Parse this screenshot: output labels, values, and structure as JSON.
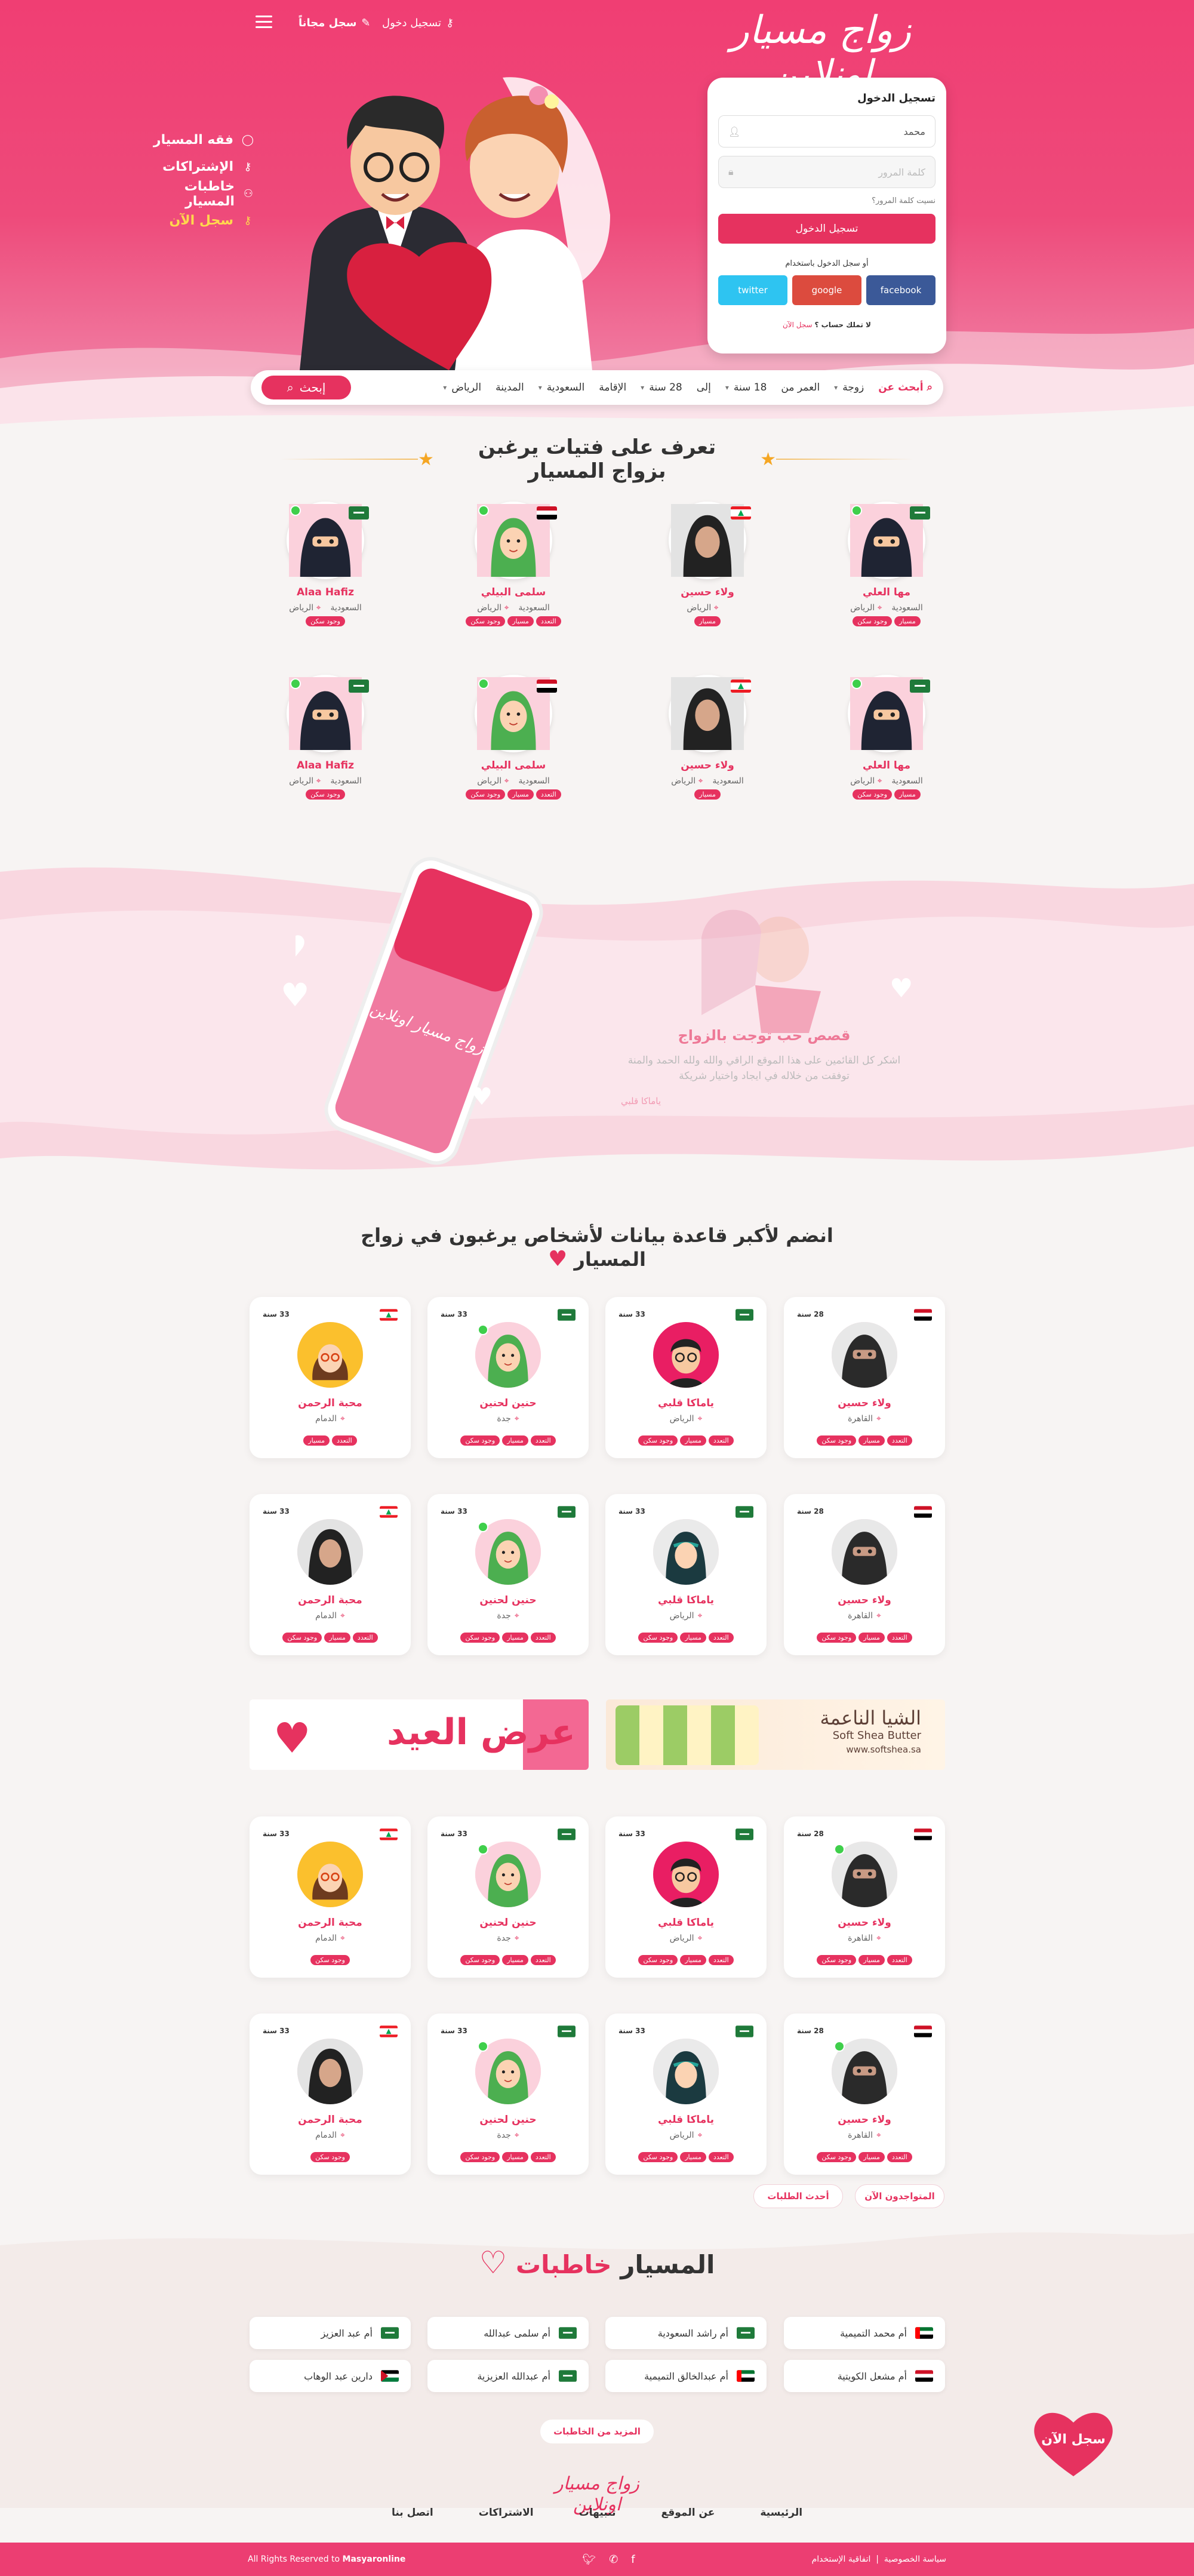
{
  "header": {
    "logo": "زواج مسيار اونلاين",
    "login_link": "تسجيل دخول",
    "register_link": "سجل مجاناً"
  },
  "side_nav": [
    {
      "label": "فقه المسيار",
      "icon": "circle-icon"
    },
    {
      "label": "الإشتراكات",
      "icon": "key-icon"
    },
    {
      "label": "خاطبات المسيار",
      "icon": "users-icon"
    },
    {
      "label": "سجل الآن",
      "icon": "key-icon"
    }
  ],
  "login": {
    "title": "تسجيل الدخول",
    "username_value": "محمد",
    "password_placeholder": "كلمة المرور",
    "forgot": "نسيت كلمة المرور؟",
    "submit": "تسجيل الدخول",
    "or_login_with": "أو سجل الدخول باستخدام",
    "facebook": "facebook",
    "google": "google",
    "twitter": "twitter",
    "no_account": "لا تملك حساب ؟",
    "register": "سجل الآن"
  },
  "search": {
    "label": "أبحث عن",
    "gender": "زوجة",
    "age_label": "العمر من",
    "age_from": "18 سنة",
    "to": "إلى",
    "age_to": "28 سنة",
    "residence_label": "الإقامة",
    "residence": "السعودية",
    "city_label": "المدينة",
    "city": "الرياض",
    "button": "إبحث"
  },
  "section1": {
    "title": "تعرف على فتيات يرغبن بزواج المسيار",
    "profiles": [
      {
        "name": "مها العلي",
        "country": "السعودية",
        "city": "الرياض",
        "tags": [
          "مسيار",
          "وجود سكن"
        ],
        "flag": "sa",
        "online": true,
        "avatar": "niqab"
      },
      {
        "name": "ولاء حسين",
        "country": "",
        "city": "الرياض",
        "tags": [
          "مسيار"
        ],
        "flag": "lb",
        "online": false,
        "avatar": "hijab-woman"
      },
      {
        "name": "سلمى البيلي",
        "country": "السعودية",
        "city": "الرياض",
        "tags": [
          "التعدد",
          "مسيار",
          "وجود سكن"
        ],
        "flag": "eg",
        "online": true,
        "avatar": "hijab-green"
      },
      {
        "name": "Alaa Hafiz",
        "country": "السعودية",
        "city": "الرياض",
        "tags": [
          "وجود سكن"
        ],
        "flag": "sa",
        "online": true,
        "avatar": "niqab"
      },
      {
        "name": "مها العلي",
        "country": "السعودية",
        "city": "الرياض",
        "tags": [
          "مسيار",
          "وجود سكن"
        ],
        "flag": "sa",
        "online": true,
        "avatar": "niqab"
      },
      {
        "name": "ولاء حسين",
        "country": "السعودية",
        "city": "الرياض",
        "tags": [
          "مسيار"
        ],
        "flag": "lb",
        "online": false,
        "avatar": "hijab-woman"
      },
      {
        "name": "سلمى البيلي",
        "country": "السعودية",
        "city": "الرياض",
        "tags": [
          "التعدد",
          "مسيار",
          "وجود سكن"
        ],
        "flag": "eg",
        "online": true,
        "avatar": "hijab-green"
      },
      {
        "name": "Alaa Hafiz",
        "country": "السعودية",
        "city": "الرياض",
        "tags": [
          "وجود سكن"
        ],
        "flag": "sa",
        "online": true,
        "avatar": "niqab"
      }
    ]
  },
  "story": {
    "phone_logo": "زواج مسيار اونلاين",
    "title": "قصص حب توجت بالزواج",
    "text": "اشكر كل القائمين على هذا الموقع الراقي والله ولله الحمد والمنة توفقت من خلاله في ايجاد واختيار شريكة",
    "author": "ياماكا قلبي"
  },
  "section2": {
    "title": "انضم لأكبر قاعدة بيانات لأشخاص يرغبون في زواج المسيار",
    "cards": [
      {
        "age": "28 سنة",
        "name": "ولاء حسين",
        "city": "القاهرة",
        "tags": [
          "التعدد",
          "مسيار",
          "وجود سكن"
        ],
        "flag": "eg",
        "online": false,
        "avatar": "niqab-dark"
      },
      {
        "age": "33 سنة",
        "name": "ياماكا قلبي",
        "city": "الرياض",
        "tags": [
          "التعدد",
          "مسيار",
          "وجود سكن"
        ],
        "flag": "sa",
        "online": false,
        "avatar": "man-pink"
      },
      {
        "age": "33 سنة",
        "name": "حنين لحنين",
        "city": "جدة",
        "tags": [
          "التعدد",
          "مسيار",
          "وجود سكن"
        ],
        "flag": "sa",
        "online": true,
        "avatar": "hijab-green"
      },
      {
        "age": "33 سنة",
        "name": "محبة الرحمن",
        "city": "الدمام",
        "tags": [
          "التعدد",
          "مسيار"
        ],
        "flag": "lb",
        "online": false,
        "avatar": "glasses-woman"
      },
      {
        "age": "28 سنة",
        "name": "ولاء حسين",
        "city": "القاهرة",
        "tags": [
          "التعدد",
          "مسيار",
          "وجود سكن"
        ],
        "flag": "eg",
        "online": false,
        "avatar": "niqab-dark"
      },
      {
        "age": "33 سنة",
        "name": "ياماكا قلبي",
        "city": "الرياض",
        "tags": [
          "التعدد",
          "مسيار",
          "وجود سكن"
        ],
        "flag": "sa",
        "online": false,
        "avatar": "hijab-teal"
      },
      {
        "age": "33 سنة",
        "name": "حنين لحنين",
        "city": "جدة",
        "tags": [
          "التعدد",
          "مسيار",
          "وجود سكن"
        ],
        "flag": "sa",
        "online": true,
        "avatar": "hijab-green"
      },
      {
        "age": "33 سنة",
        "name": "محبة الرحمن",
        "city": "الدمام",
        "tags": [
          "التعدد",
          "مسيار",
          "وجود سكن"
        ],
        "flag": "lb",
        "online": false,
        "avatar": "hijab-woman"
      },
      {
        "age": "28 سنة",
        "name": "ولاء حسين",
        "city": "القاهرة",
        "tags": [
          "التعدد",
          "مسيار",
          "وجود سكن"
        ],
        "flag": "eg",
        "online": true,
        "avatar": "niqab-dark"
      },
      {
        "age": "33 سنة",
        "name": "ياماكا قلبي",
        "city": "الرياض",
        "tags": [
          "التعدد",
          "مسيار",
          "وجود سكن"
        ],
        "flag": "sa",
        "online": false,
        "avatar": "man-pink"
      },
      {
        "age": "33 سنة",
        "name": "حنين لحنين",
        "city": "جدة",
        "tags": [
          "التعدد",
          "مسيار",
          "وجود سكن"
        ],
        "flag": "sa",
        "online": true,
        "avatar": "hijab-green"
      },
      {
        "age": "33 سنة",
        "name": "محبة الرحمن",
        "city": "الدمام",
        "tags": [
          "وجود سكن"
        ],
        "flag": "lb",
        "online": false,
        "avatar": "glasses-woman"
      },
      {
        "age": "28 سنة",
        "name": "ولاء حسين",
        "city": "القاهرة",
        "tags": [
          "التعدد",
          "مسيار",
          "وجود سكن"
        ],
        "flag": "eg",
        "online": true,
        "avatar": "niqab-dark"
      },
      {
        "age": "33 سنة",
        "name": "ياماكا قلبي",
        "city": "الرياض",
        "tags": [
          "التعدد",
          "مسيار",
          "وجود سكن"
        ],
        "flag": "sa",
        "online": false,
        "avatar": "hijab-teal"
      },
      {
        "age": "33 سنة",
        "name": "حنين لحنين",
        "city": "جدة",
        "tags": [
          "التعدد",
          "مسيار",
          "وجود سكن"
        ],
        "flag": "sa",
        "online": true,
        "avatar": "hijab-green"
      },
      {
        "age": "33 سنة",
        "name": "محبة الرحمن",
        "city": "الدمام",
        "tags": [
          "وجود سكن"
        ],
        "flag": "lb",
        "online": false,
        "avatar": "hijab-woman"
      }
    ],
    "tab_online": "المتواجدون الآن",
    "tab_latest": "أحدث الطلبات"
  },
  "banners": {
    "shea_ar": "الشيا الناعمة",
    "shea_en": "Soft Shea Butter",
    "shea_url": "www.softshea.sa",
    "eid": "عرض العيد"
  },
  "matchmakers": {
    "title_a": "خاطبات",
    "title_b": "المسيار",
    "items": [
      {
        "name": "أم محمد التميمية",
        "flag": "ae"
      },
      {
        "name": "أم راشد السعودية",
        "flag": "sa"
      },
      {
        "name": "أم سلمى عبدالله",
        "flag": "sa"
      },
      {
        "name": "أم عبد العزيز",
        "flag": "sa"
      },
      {
        "name": "أم مشعل الكويتية",
        "flag": "eg"
      },
      {
        "name": "أم عبدالخالق التميمية",
        "flag": "ae"
      },
      {
        "name": "أم عبدالله العزيزية",
        "flag": "sa"
      },
      {
        "name": "دارين عبد الوهاب",
        "flag": "ps"
      }
    ],
    "more": "المزيد من الخاطبات"
  },
  "float_cta": "سجل الآن",
  "footer": {
    "logo": "زواج مسيار اونلاين",
    "nav": [
      "الرئيسية",
      "عن الموقع",
      "تنبيهات",
      "الاشتراكات",
      "اتصل بنا"
    ],
    "privacy": "سياسة الخصوصية",
    "terms": "اتفاقية الإستخدام",
    "copyright": "All Rights Reserved to",
    "brand": "Masyaronline"
  },
  "colors": {
    "primary": "#e6325f",
    "hero": "#f03e73",
    "online": "#3fcf4b",
    "gold": "#f5a623"
  }
}
